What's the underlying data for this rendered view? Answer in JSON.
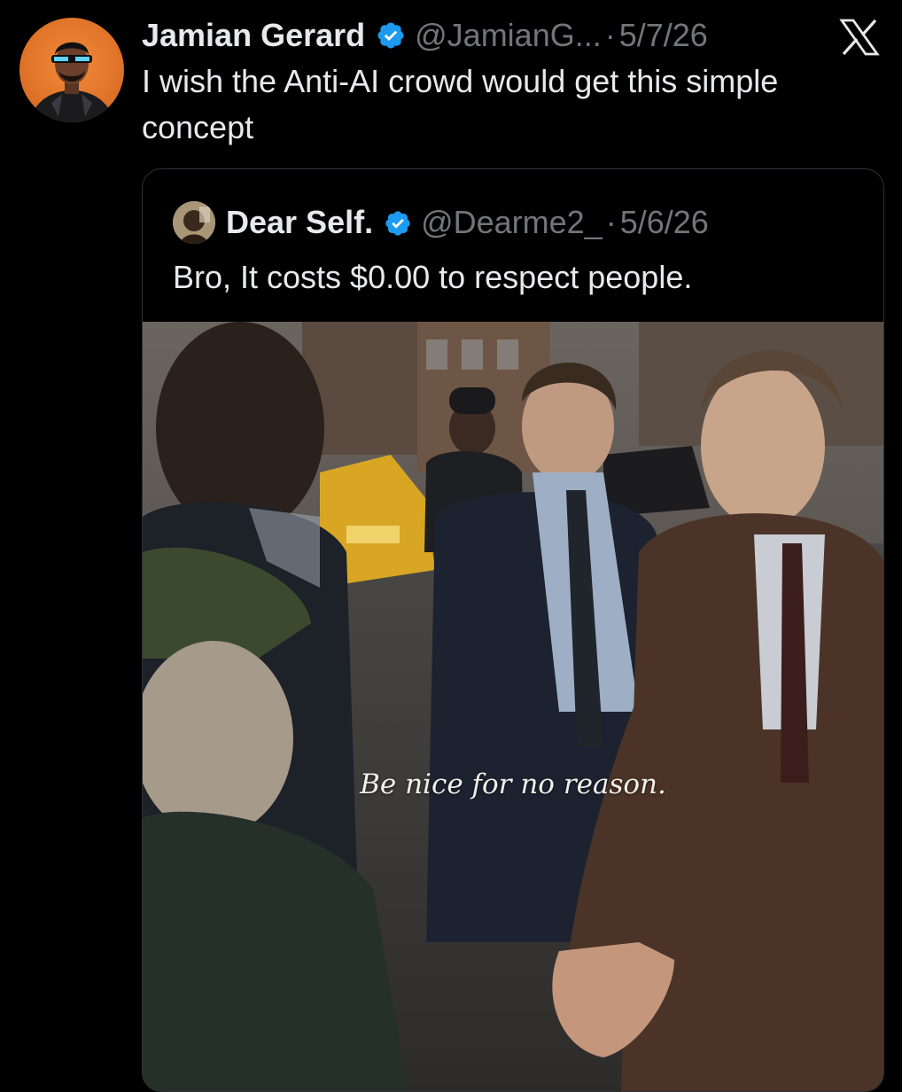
{
  "tweet": {
    "author_name": "Jamian Gerard",
    "handle": "@JamianG...",
    "separator": "·",
    "date": "5/7/26",
    "text": "I wish the Anti-AI crowd would get this simple concept",
    "verified": true
  },
  "quoted_tweet": {
    "author_name": "Dear Self.",
    "handle": "@Dearme2_",
    "separator": "·",
    "date": "5/6/26",
    "text": "Bro, It costs $0.00 to respect people.",
    "verified": true,
    "image_caption": "Be nice for no reason."
  },
  "icons": {
    "platform_logo": "x-logo-icon",
    "verified_badge": "verified-badge-icon"
  },
  "colors": {
    "background": "#000000",
    "primary_text": "#e7e9ea",
    "secondary_text": "#71767b",
    "verified_blue": "#1d9bf0",
    "avatar_orange": "#e2762a"
  }
}
